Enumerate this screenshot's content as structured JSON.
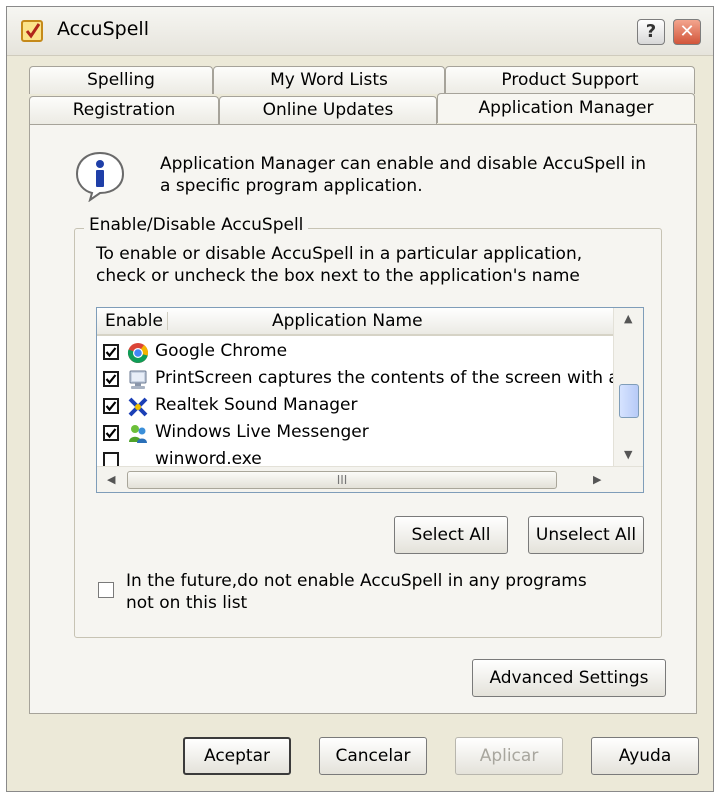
{
  "window": {
    "title": "AccuSpell"
  },
  "tabs": {
    "row1": [
      "Spelling",
      "My Word Lists",
      "Product Support"
    ],
    "row2": [
      "Registration",
      "Online Updates",
      "Application Manager"
    ]
  },
  "info": {
    "text": "Application Manager can enable and disable AccuSpell in a specific program application."
  },
  "group": {
    "label": "Enable/Disable AccuSpell",
    "description": "To enable or disable AccuSpell in a particular application, check or uncheck the box next to the application's name"
  },
  "list": {
    "col_enable": "Enable",
    "col_name": "Application Name",
    "hscroll_grip": "III",
    "rows": [
      {
        "name": "Google Chrome",
        "checked": true,
        "icon": "chrome-icon"
      },
      {
        "name": "PrintScreen captures the contents of the screen with a singl",
        "checked": true,
        "icon": "printscreen-icon"
      },
      {
        "name": "Realtek Sound Manager",
        "checked": true,
        "icon": "realtek-icon"
      },
      {
        "name": "Windows Live Messenger",
        "checked": true,
        "icon": "messenger-icon"
      },
      {
        "name": "winword.exe",
        "checked": false,
        "icon": ""
      }
    ]
  },
  "buttons": {
    "select_all": "Select All",
    "unselect_all": "Unselect All",
    "advanced": "Advanced Settings",
    "ok": "Aceptar",
    "cancel": "Cancelar",
    "apply": "Aplicar",
    "help": "Ayuda"
  },
  "future": {
    "text": "In the future,do not enable AccuSpell in any programs not on this list",
    "checked": false
  },
  "colors": {
    "panel": "#f6f5f1",
    "window": "#ece9d8",
    "close": "#d2553a"
  }
}
